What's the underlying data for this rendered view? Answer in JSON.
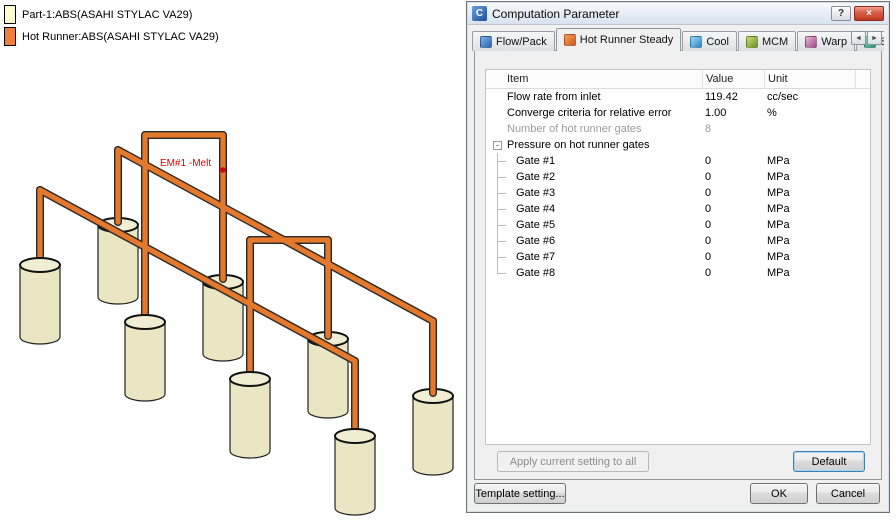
{
  "legend": {
    "items": [
      {
        "label": "Part-1:ABS(ASAHI STYLAC VA29)",
        "color": "#ffffd2"
      },
      {
        "label": "Hot Runner:ABS(ASAHI STYLAC VA29)",
        "color": "#f07f3c"
      }
    ]
  },
  "scene": {
    "melt_label": "EM#1 -Melt",
    "runner_color": "#e4782c",
    "part_color": "#eae6c3"
  },
  "dialog": {
    "title": "Computation Parameter",
    "titlebar": {
      "icon_glyph": "C",
      "help_glyph": "?",
      "close_glyph": "×"
    },
    "tab_scroll": {
      "left_glyph": "◄",
      "right_glyph": "►"
    },
    "tabs": [
      {
        "label": "Flow/Pack",
        "icon": "flow-pack-icon",
        "active": false
      },
      {
        "label": "Hot Runner Steady",
        "icon": "hot-runner-icon",
        "active": true
      },
      {
        "label": "Cool",
        "icon": "cool-icon",
        "active": false
      },
      {
        "label": "MCM",
        "icon": "mcm-icon",
        "active": false
      },
      {
        "label": "Warp",
        "icon": "warp-icon",
        "active": false
      },
      {
        "label": "S",
        "icon": "stress-icon",
        "active": false
      }
    ],
    "table": {
      "headers": [
        "Item",
        "Value",
        "Unit"
      ],
      "rows": [
        {
          "item": "Flow rate from inlet",
          "value": "119.42",
          "unit": "cc/sec"
        },
        {
          "item": "Converge criteria for relative error",
          "value": "1.00",
          "unit": "%"
        },
        {
          "item": "Number of hot runner gates",
          "value": "8",
          "unit": "",
          "disabled": true
        },
        {
          "item": "Pressure on hot runner gates",
          "value": "",
          "unit": "",
          "expander": "-"
        },
        {
          "item": "Gate #1",
          "value": "0",
          "unit": "MPa",
          "tree": true
        },
        {
          "item": "Gate #2",
          "value": "0",
          "unit": "MPa",
          "tree": true
        },
        {
          "item": "Gate #3",
          "value": "0",
          "unit": "MPa",
          "tree": true
        },
        {
          "item": "Gate #4",
          "value": "0",
          "unit": "MPa",
          "tree": true
        },
        {
          "item": "Gate #5",
          "value": "0",
          "unit": "MPa",
          "tree": true
        },
        {
          "item": "Gate #6",
          "value": "0",
          "unit": "MPa",
          "tree": true
        },
        {
          "item": "Gate #7",
          "value": "0",
          "unit": "MPa",
          "tree": true
        },
        {
          "item": "Gate #8",
          "value": "0",
          "unit": "MPa",
          "tree": true
        }
      ]
    },
    "buttons": {
      "apply_all": "Apply current setting to all",
      "default": "Default",
      "template": "Template setting...",
      "ok": "OK",
      "cancel": "Cancel"
    }
  }
}
